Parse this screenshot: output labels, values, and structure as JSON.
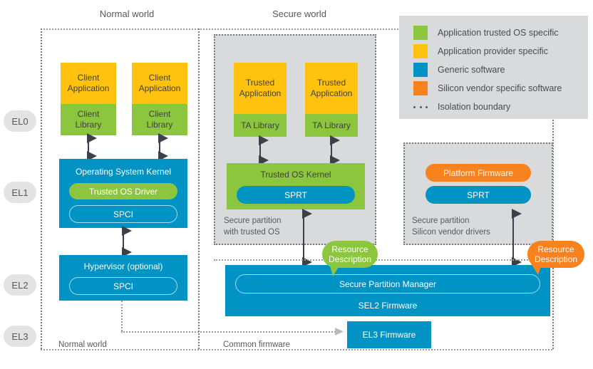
{
  "diagram": {
    "normal_world_title": "Normal world",
    "secure_world_title": "Secure world",
    "normal_world_footer": "Normal world",
    "common_firmware_footer": "Common firmware"
  },
  "exception_levels": [
    {
      "id": "el0",
      "label": "EL0"
    },
    {
      "id": "el1",
      "label": "EL1"
    },
    {
      "id": "el2",
      "label": "EL2"
    },
    {
      "id": "el3",
      "label": "EL3"
    }
  ],
  "normal_world": {
    "client_stacks": [
      {
        "app": "Client\nApplication",
        "app_line1": "Client",
        "app_line2": "Application",
        "lib_line1": "Client",
        "lib_line2": "Library"
      },
      {
        "app_line1": "Client",
        "app_line2": "Application",
        "lib_line1": "Client",
        "lib_line2": "Library"
      }
    ],
    "os_kernel": {
      "title": "Operating System Kernel",
      "driver": "Trusted OS Driver",
      "interface": "SPCI"
    },
    "hypervisor": {
      "title": "Hypervisor (optional)",
      "interface": "SPCI"
    }
  },
  "secure_world": {
    "trusted_partition": {
      "apps": [
        {
          "app_line1": "Trusted",
          "app_line2": "Application",
          "lib": "TA Library"
        },
        {
          "app_line1": "Trusted",
          "app_line2": "Application",
          "lib": "TA Library"
        }
      ],
      "kernel_title": "Trusted OS Kernel",
      "kernel_interface": "SPRT",
      "caption_line1": "Secure partition",
      "caption_line2": "with trusted OS"
    },
    "vendor_partition": {
      "firmware": "Platform Firmware",
      "interface": "SPRT",
      "caption_line1": "Secure partition",
      "caption_line2": "Silicon vendor drivers"
    },
    "sel2": {
      "manager": "Secure Partition Manager",
      "title": "SEL2 Firmware"
    },
    "el3_firmware": "EL3 Firmware"
  },
  "callouts": [
    {
      "id": "resource-description-left",
      "line1": "Resource",
      "line2": "Description",
      "color": "#8cc63e"
    },
    {
      "id": "resource-description-right",
      "line1": "Resource",
      "line2": "Description",
      "color": "#f7821e"
    }
  ],
  "legend": {
    "items": [
      {
        "label": "Application trusted OS specific",
        "color": "#8cc63e",
        "type": "swatch"
      },
      {
        "label": "Application provider specific",
        "color": "#ffc20e",
        "type": "swatch"
      },
      {
        "label": "Generic software",
        "color": "#0093c4",
        "type": "swatch"
      },
      {
        "label": "Silicon vendor specific software",
        "color": "#f7821e",
        "type": "swatch"
      },
      {
        "label": "Isolation boundary",
        "color": "#58595b",
        "type": "dots"
      }
    ]
  },
  "colors": {
    "green": "#8cc63e",
    "yellow": "#ffc20e",
    "blue": "#0093c4",
    "orange": "#f7821e",
    "panel_gray": "#d9dadb",
    "badge_gray": "#e3e3e3",
    "text_gray": "#58595b"
  }
}
